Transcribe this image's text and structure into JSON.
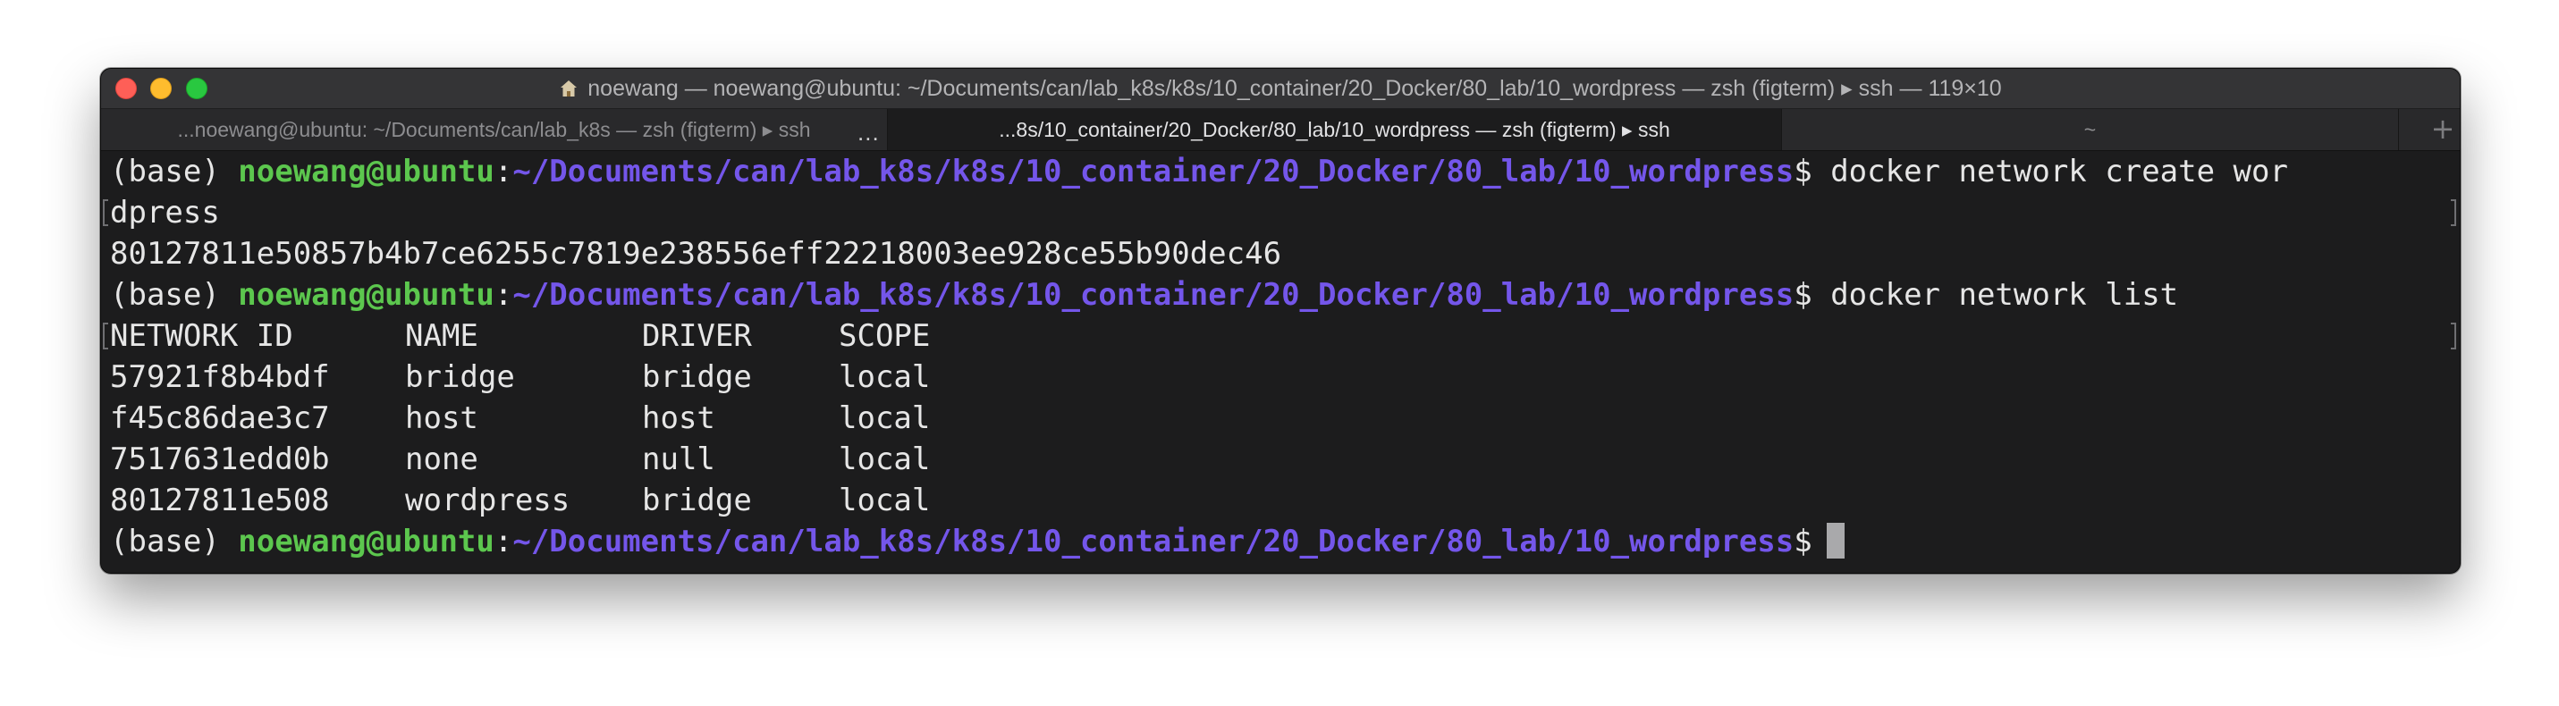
{
  "window": {
    "title": "noewang — noewang@ubuntu: ~/Documents/can/lab_k8s/k8s/10_container/20_Docker/80_lab/10_wordpress — zsh (figterm) ▸ ssh — 119×10",
    "title_icon": "home-icon"
  },
  "tabs": [
    {
      "label": "...noewang@ubuntu: ~/Documents/can/lab_k8s — zsh (figterm) ▸ ssh",
      "active": false
    },
    {
      "label": "...8s/10_container/20_Docker/80_lab/10_wordpress — zsh (figterm) ▸ ssh",
      "active": true
    },
    {
      "label": "~",
      "active": false
    }
  ],
  "tab_overflow": "...",
  "tab_add": "+",
  "prompt": {
    "env": "(base) ",
    "user_host": "noewang@ubuntu",
    "colon": ":",
    "path": "~/Documents/can/lab_k8s/k8s/10_container/20_Docker/80_lab/10_wordpress",
    "symbol": "$"
  },
  "commands": {
    "cmd1_part1": " docker network create wor",
    "cmd1_part2": "dpress",
    "cmd1_output": "80127811e50857b4b7ce6255c7819e238556eff22218003ee928ce55b90dec46",
    "cmd2": " docker network list"
  },
  "network_table": {
    "headers": [
      "NETWORK ID",
      "NAME",
      "DRIVER",
      "SCOPE"
    ],
    "rows": [
      [
        "57921f8b4bdf",
        "bridge",
        "bridge",
        "local"
      ],
      [
        "f45c86dae3c7",
        "host",
        "host",
        "local"
      ],
      [
        "7517631edd0b",
        "none",
        "null",
        "local"
      ],
      [
        "80127811e508",
        "wordpress",
        "bridge",
        "local"
      ]
    ]
  },
  "colors": {
    "user_host": "#5cc74e",
    "path": "#7456ea",
    "background": "#1c1c1d",
    "close": "#fe5f57",
    "minimize": "#febc2e",
    "maximize": "#29c840"
  }
}
